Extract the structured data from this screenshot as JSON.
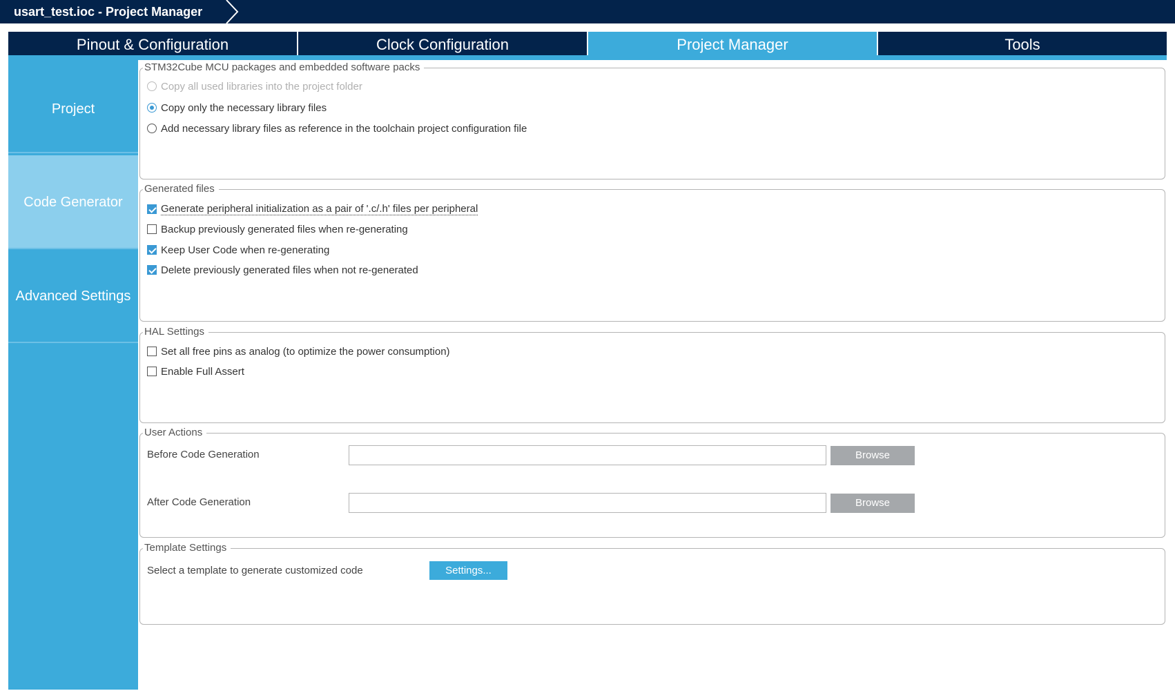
{
  "window": {
    "title": "usart_test.ioc - Project Manager"
  },
  "tabs": [
    {
      "label": "Pinout & Configuration",
      "active": false
    },
    {
      "label": "Clock Configuration",
      "active": false
    },
    {
      "label": "Project Manager",
      "active": true
    },
    {
      "label": "Tools",
      "active": false
    }
  ],
  "sidebar": {
    "items": [
      {
        "label": "Project",
        "active": false
      },
      {
        "label": "Code Generator",
        "active": true
      },
      {
        "label": "Advanced Settings",
        "active": false
      }
    ]
  },
  "packs": {
    "legend": "STM32Cube MCU packages and embedded software packs",
    "options": [
      {
        "label": "Copy all used libraries into the project folder",
        "selected": false,
        "enabled": false
      },
      {
        "label": "Copy only the necessary library files",
        "selected": true,
        "enabled": true
      },
      {
        "label": "Add necessary library files as reference in the toolchain project configuration file",
        "selected": false,
        "enabled": true
      }
    ]
  },
  "generated": {
    "legend": "Generated files",
    "options": [
      {
        "label": "Generate peripheral initialization as a pair of '.c/.h' files per peripheral",
        "checked": true
      },
      {
        "label": "Backup previously generated files when re-generating",
        "checked": false
      },
      {
        "label": "Keep User Code when re-generating",
        "checked": true
      },
      {
        "label": "Delete previously generated files when not re-generated",
        "checked": true
      }
    ]
  },
  "hal": {
    "legend": "HAL Settings",
    "options": [
      {
        "label": "Set all free pins as analog (to optimize the power consumption)",
        "checked": false
      },
      {
        "label": "Enable Full Assert",
        "checked": false
      }
    ]
  },
  "user_actions": {
    "legend": "User Actions",
    "before_label": "Before Code Generation",
    "before_value": "",
    "after_label": "After Code Generation",
    "after_value": "",
    "browse_label": "Browse"
  },
  "template": {
    "legend": "Template Settings",
    "label": "Select a template to generate customized code",
    "button_label": "Settings..."
  },
  "colors": {
    "navy": "#03234b",
    "accent": "#3cabdb",
    "nav_active": "#8ccfed",
    "check": "#3a99d4"
  }
}
